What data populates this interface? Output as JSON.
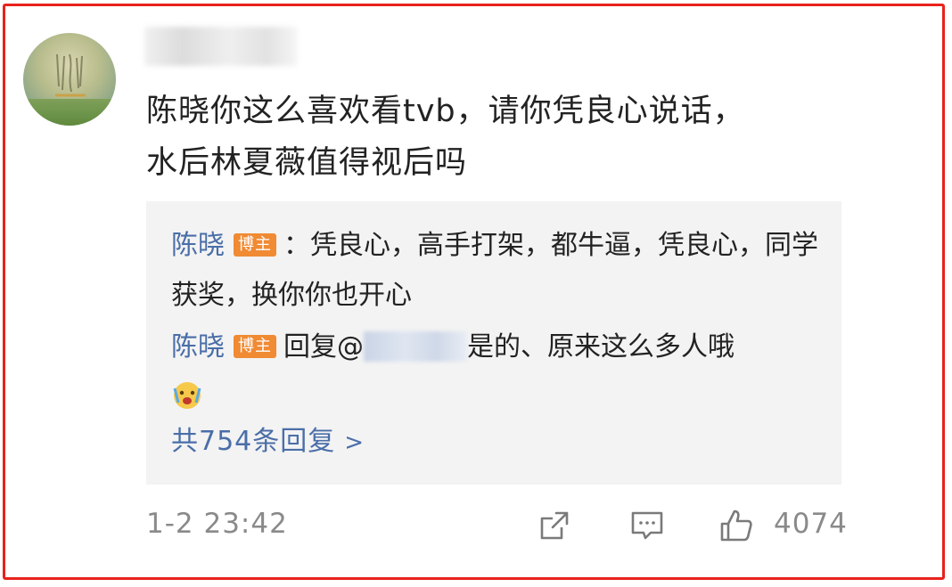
{
  "comment": {
    "text_line1": "陈晓你这么喜欢看tvb，请你凭良心说话，",
    "text_line2": "水后林夏薇值得视后吗"
  },
  "replies": [
    {
      "author": "陈晓",
      "badge": "博主",
      "text": "：凭良心，高手打架，都牛逼，凭良心，同学获奖，换你你也开心"
    },
    {
      "author": "陈晓",
      "badge": "博主",
      "prefix": "回复@",
      "text": "是的、原来这么多人哦"
    }
  ],
  "more_replies": "共754条回复",
  "more_replies_chevron": ">",
  "timestamp": "1-2 23:42",
  "like_count": "4074",
  "icons": [
    "share-icon",
    "reply-icon",
    "like-icon",
    "emoji-icon"
  ],
  "colors": {
    "frame": "#e8221c",
    "link": "#4a6ea8",
    "badge": "#f08a33",
    "meta": "#8a8a8a"
  }
}
